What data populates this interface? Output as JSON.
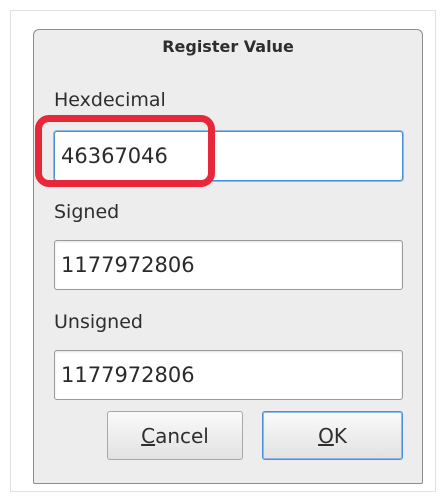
{
  "dialog": {
    "title": "Register Value",
    "fields": {
      "hex": {
        "label": "Hexdecimal",
        "value": "46367046"
      },
      "signed": {
        "label": "Signed",
        "value": "1177972806"
      },
      "unsigned": {
        "label": "Unsigned",
        "value": "1177972806"
      }
    },
    "buttons": {
      "cancel": {
        "mnemonic": "C",
        "rest": "ancel"
      },
      "ok": {
        "mnemonic": "O",
        "rest": "K"
      }
    }
  },
  "colors": {
    "highlight": "#e8283a",
    "focus": "#4a90d9"
  }
}
